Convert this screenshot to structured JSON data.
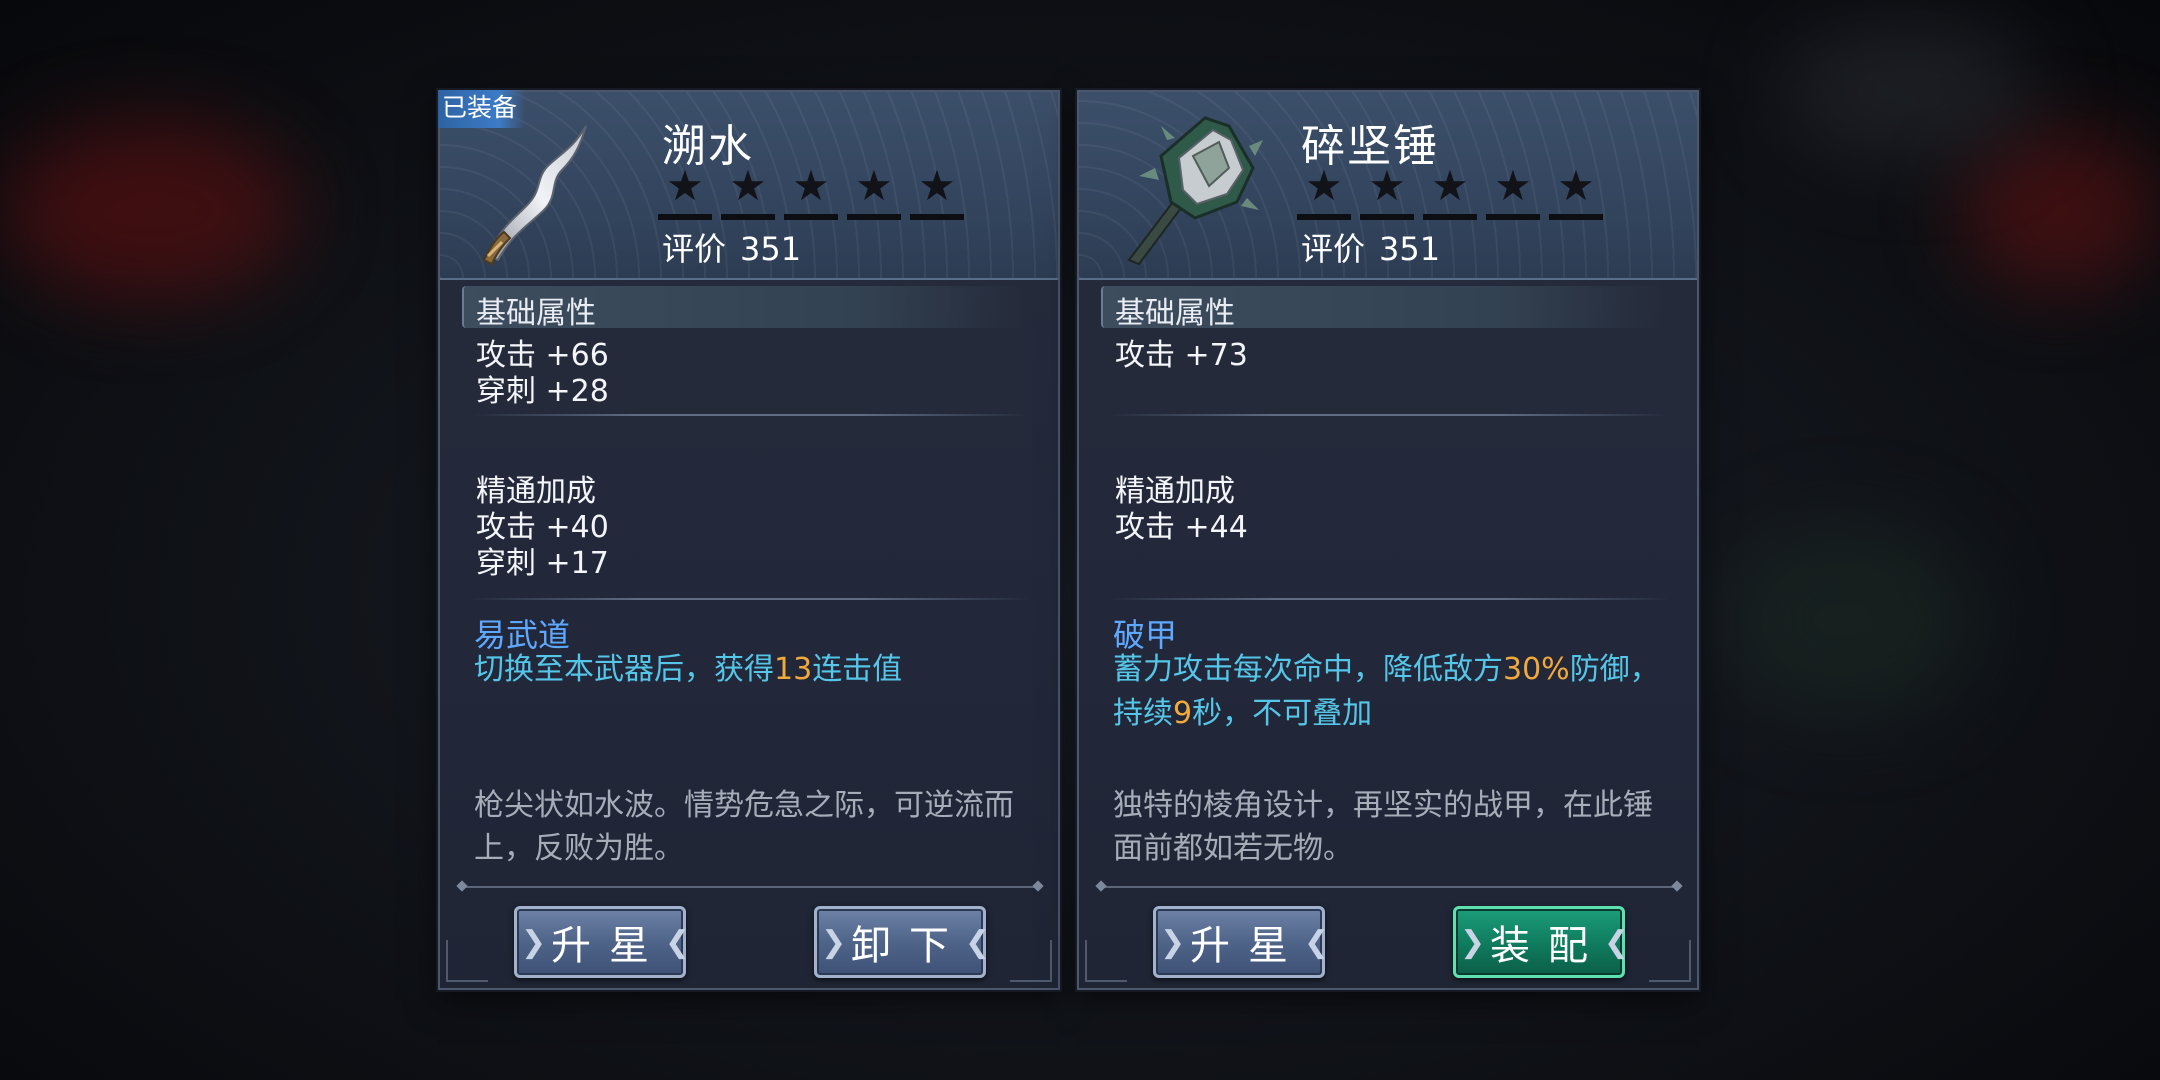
{
  "cards": [
    {
      "equipped_badge": "已装备",
      "name": "溯水",
      "stars": [
        "★",
        "★",
        "★",
        "★",
        "★"
      ],
      "rating_label": "评价",
      "rating_value": "351",
      "base_title": "基础属性",
      "base_stats": [
        "攻击 +66",
        "穿刺 +28"
      ],
      "mastery_title": "精通加成",
      "mastery_stats": [
        "攻击 +40",
        "穿刺 +17"
      ],
      "skill_name": "易武道",
      "skill_desc_parts": [
        "切换至本武器后，获得",
        "13",
        "连击值"
      ],
      "flavor": "枪尖状如水波。情势危急之际，可逆流而上，反败为胜。",
      "button_left": "升星",
      "button_right": "卸下"
    },
    {
      "name": "碎坚锤",
      "stars": [
        "★",
        "★",
        "★",
        "★",
        "★"
      ],
      "rating_label": "评价",
      "rating_value": "351",
      "base_title": "基础属性",
      "base_stats": [
        "攻击 +73"
      ],
      "mastery_title": "精通加成",
      "mastery_stats": [
        "攻击 +44"
      ],
      "skill_name": "破甲",
      "skill_desc_parts": [
        "蓄力攻击每次命中，降低敌方",
        "30%",
        "防御，持续",
        "9",
        "秒，不可叠加"
      ],
      "flavor": "独特的棱角设计，再坚实的战甲，在此锤面前都如若无物。",
      "button_left": "升星",
      "button_right": "装配"
    }
  ],
  "colors": {
    "skill_name": "#5fa8ff",
    "skill_desc": "#55c6e8",
    "highlight": "#f2a93b",
    "equip_button": "#0f7a5d",
    "default_button": "#4f6489"
  }
}
